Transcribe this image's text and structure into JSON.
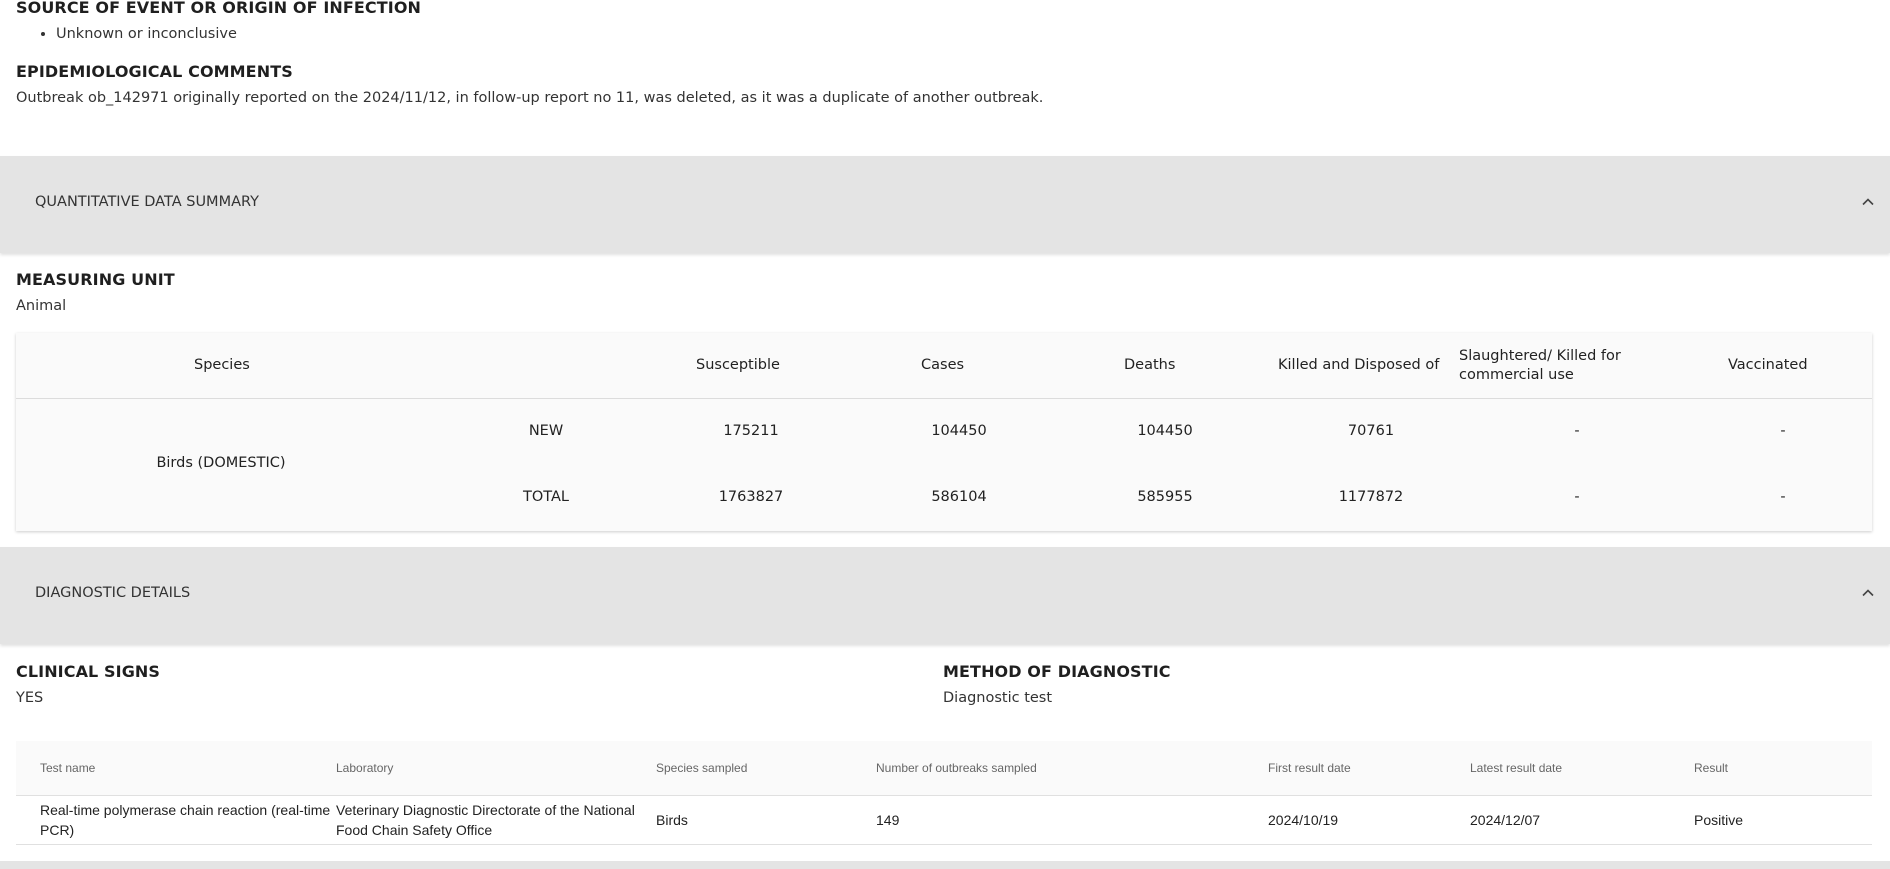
{
  "source": {
    "title": "SOURCE OF EVENT OR ORIGIN OF INFECTION",
    "items": [
      "Unknown or inconclusive"
    ]
  },
  "epidemiological": {
    "title": "EPIDEMIOLOGICAL COMMENTS",
    "text": "Outbreak ob_142971 originally reported on the 2024/11/12, in follow-up report no 11, was deleted, as it was a duplicate of another outbreak."
  },
  "quantitative_summary": {
    "band_title": "QUANTITATIVE DATA SUMMARY",
    "measuring_unit_title": "MEASURING UNIT",
    "measuring_unit_value": "Animal",
    "headers": {
      "species": "Species",
      "susceptible": "Susceptible",
      "cases": "Cases",
      "deaths": "Deaths",
      "killed": "Killed and Disposed of",
      "slaughtered": "Slaughtered/ Killed for commercial use",
      "vaccinated": "Vaccinated"
    },
    "species_name": "Birds (DOMESTIC)",
    "rows": [
      {
        "label": "NEW",
        "susceptible": "175211",
        "cases": "104450",
        "deaths": "104450",
        "killed": "70761",
        "slaughtered": "-",
        "vaccinated": "-"
      },
      {
        "label": "TOTAL",
        "susceptible": "1763827",
        "cases": "586104",
        "deaths": "585955",
        "killed": "1177872",
        "slaughtered": "-",
        "vaccinated": "-"
      }
    ]
  },
  "diagnostic_details": {
    "band_title": "DIAGNOSTIC DETAILS",
    "clinical_signs_title": "CLINICAL SIGNS",
    "clinical_signs_value": "YES",
    "method_title": "METHOD OF DIAGNOSTIC",
    "method_value": "Diagnostic test",
    "headers": {
      "test_name": "Test name",
      "laboratory": "Laboratory",
      "species_sampled": "Species sampled",
      "outbreaks_sampled": "Number of outbreaks sampled",
      "first_result": "First result date",
      "latest_result": "Latest result date",
      "result": "Result"
    },
    "rows": [
      {
        "test_name": "Real-time polymerase chain reaction (real-time PCR)",
        "laboratory": "Veterinary Diagnostic Directorate of the National Food Chain Safety Office",
        "species_sampled": "Birds",
        "outbreaks_sampled": "149",
        "first_result": "2024/10/19",
        "latest_result": "2024/12/07",
        "result": "Positive"
      }
    ]
  },
  "icons": {
    "collapse": "chevron-up-icon"
  }
}
